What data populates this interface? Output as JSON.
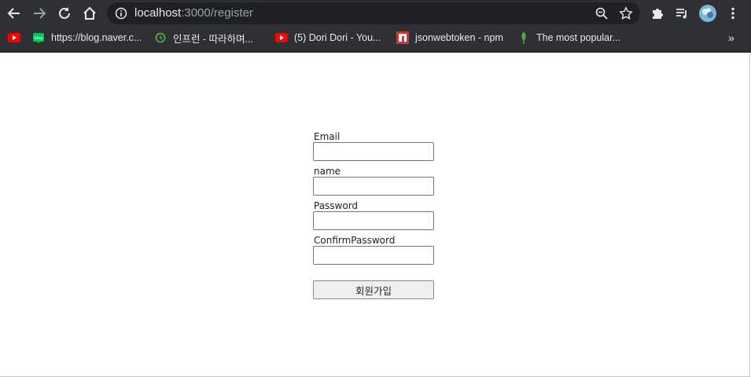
{
  "browser": {
    "url_host": "localhost",
    "url_path": ":3000/register",
    "bookmarks": [
      {
        "label": "",
        "icon": "youtube-icon"
      },
      {
        "label": "https://blog.naver.c...",
        "icon": "naver-blog-icon"
      },
      {
        "label": "인프런 - 따라하며...",
        "icon": "inflearn-icon"
      },
      {
        "label": "(5) Dori Dori - You...",
        "icon": "youtube-icon"
      },
      {
        "label": "jsonwebtoken - npm",
        "icon": "npm-icon"
      },
      {
        "label": "The most popular...",
        "icon": "mongodb-leaf-icon"
      }
    ],
    "overflow_label": "»"
  },
  "form": {
    "email_label": "Email",
    "email_value": "",
    "name_label": "name",
    "name_value": "",
    "password_label": "Password",
    "password_value": "",
    "confirm_label": "ConfirmPassword",
    "confirm_value": "",
    "submit_label": "회원가입"
  },
  "colors": {
    "toolbar": "#2f3033",
    "omnibox": "#1f2023",
    "youtube": "#ff0000",
    "naver": "#03c75a",
    "npm": "#cb3837",
    "mongodb": "#4faa41"
  }
}
